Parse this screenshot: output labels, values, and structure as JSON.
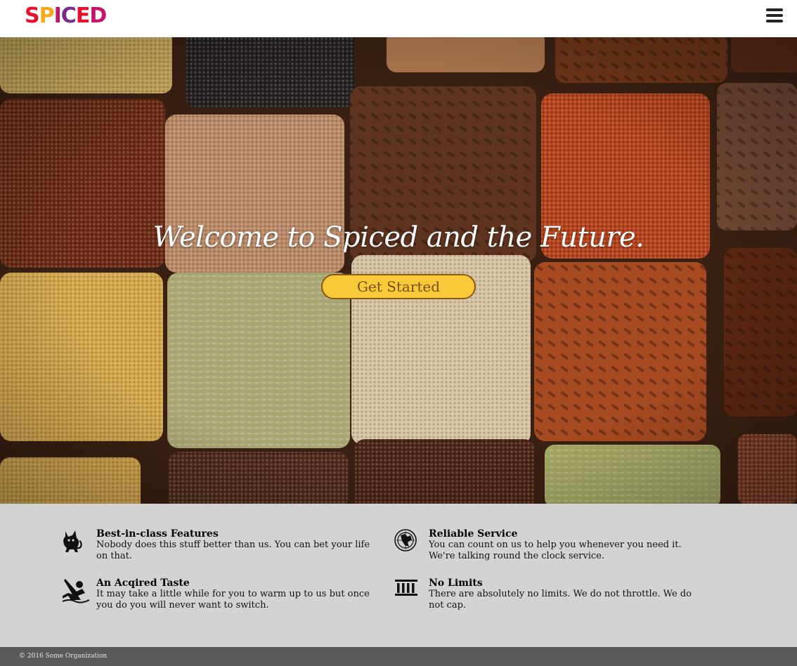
{
  "header": {
    "logo_text": "SPICED",
    "logo_colors": [
      "#e8112d",
      "#f7a81b",
      "#c7146b",
      "#7b2a8c",
      "#e8112d",
      "#c7146b"
    ],
    "menu_icon": "hamburger-menu-icon"
  },
  "hero": {
    "title": "Welcome to Spiced and the Future.",
    "cta_label": "Get Started",
    "cta_color": "#f9c93a"
  },
  "features": [
    {
      "icon": "cat-icon",
      "title": "Best-in-class Features",
      "text": "Nobody does this stuff better than us. You can bet your life on that."
    },
    {
      "icon": "globe-icon",
      "title": "Reliable Service",
      "text": "You can count on us to help you whenever you need it. We're talking round the clock service."
    },
    {
      "icon": "skier-icon",
      "title": "An Acqired Taste",
      "text": "It may take a little while for you to warm up to us but once you do you will never want to switch."
    },
    {
      "icon": "bank-icon",
      "title": "No Limits",
      "text": "There are absolutely no limits. We do not throttle. We do not cap."
    }
  ],
  "footer": {
    "copyright": "© 2016 Some Organization"
  }
}
